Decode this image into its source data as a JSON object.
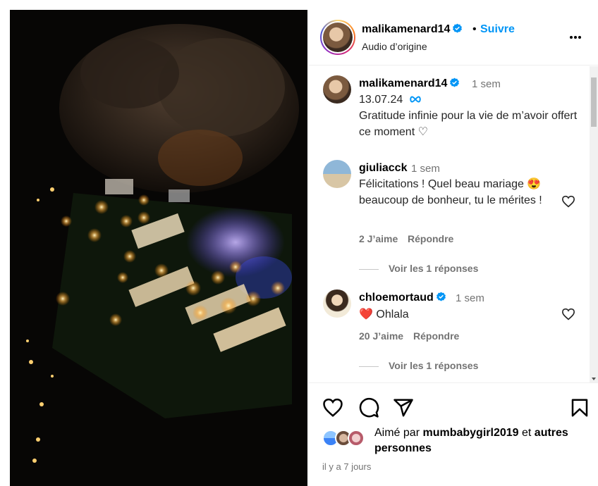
{
  "header": {
    "username": "malikamenard14",
    "follow_label": "Suivre",
    "audio_label": "Audio d’origine"
  },
  "caption": {
    "username": "malikamenard14",
    "time": "1 sem",
    "date_line": "13.07.24",
    "text": "Gratitude infinie pour la vie de m’avoir offert ce moment ♡"
  },
  "comments": [
    {
      "username": "giuliacck",
      "time": "1 sem",
      "text": "Félicitations ! Quel beau mariage 😍 beaucoup de bonheur, tu le mérites !",
      "likes": "2 J’aime",
      "reply_label": "Répondre",
      "view_replies": "Voir les 1 réponses"
    },
    {
      "username": "chloemortaud",
      "time": "1 sem",
      "text": "❤️ Ohlala",
      "likes": "20 J’aime",
      "reply_label": "Répondre",
      "view_replies": "Voir les 1 réponses"
    }
  ],
  "likes_line": {
    "prefix": "Aimé par",
    "user": "mumbabygirl2019",
    "middle": "et",
    "suffix": "autres personnes"
  },
  "posted_time": "il y a 7 jours",
  "icons": [
    "heart-icon",
    "comment-icon",
    "share-icon",
    "bookmark-icon",
    "more-icon",
    "verified-icon"
  ],
  "colors": {
    "accent": "#0095f6",
    "verified": "#0095f6",
    "text_secondary": "#737373"
  }
}
